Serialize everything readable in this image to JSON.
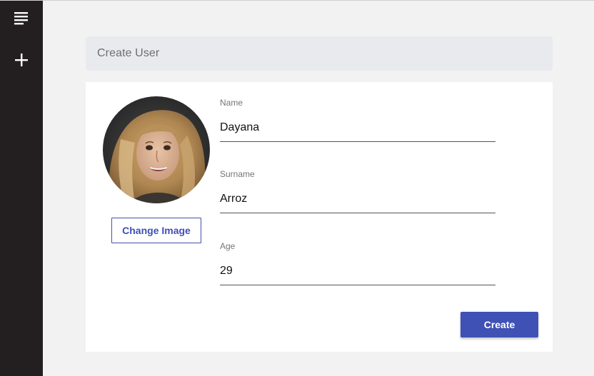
{
  "sidebar": {
    "items": [
      {
        "icon": "menu-icon"
      },
      {
        "icon": "plus-icon"
      }
    ]
  },
  "header": {
    "title": "Create User"
  },
  "form": {
    "change_image_label": "Change Image",
    "name": {
      "label": "Name",
      "value": "Dayana"
    },
    "surname": {
      "label": "Surname",
      "value": "Arroz"
    },
    "age": {
      "label": "Age",
      "value": "29"
    },
    "create_label": "Create"
  },
  "colors": {
    "sidebar": "#231f20",
    "primary": "#3f51b5",
    "header_bg": "#e8eaed",
    "page_bg": "#f2f2f2"
  }
}
